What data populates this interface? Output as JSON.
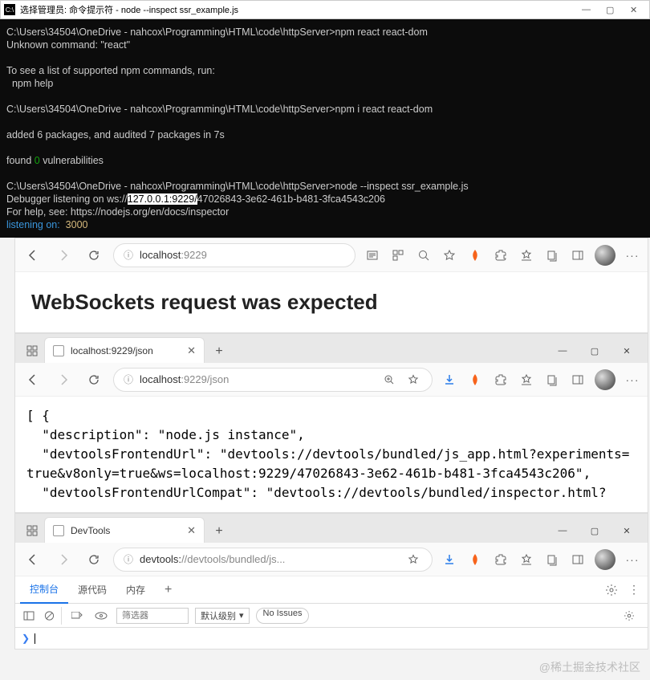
{
  "terminal": {
    "title": "选择管理员: 命令提示符 - node  --inspect ssr_example.js",
    "lines": [
      {
        "t": "C:\\Users\\34504\\OneDrive - nahcox\\Programming\\HTML\\code\\httpServer>npm react react-dom"
      },
      {
        "t": "Unknown command: \"react\""
      },
      {
        "t": ""
      },
      {
        "t": "To see a list of supported npm commands, run:"
      },
      {
        "t": "  npm help"
      },
      {
        "t": ""
      },
      {
        "t": "C:\\Users\\34504\\OneDrive - nahcox\\Programming\\HTML\\code\\httpServer>npm i react react-dom"
      },
      {
        "t": ""
      },
      {
        "t": "added 6 packages, and audited 7 packages in 7s"
      },
      {
        "t": ""
      },
      {
        "pre": "found ",
        "mid": "0",
        "suf": " vulnerabilities",
        "midcls": "green"
      },
      {
        "t": ""
      },
      {
        "t": "C:\\Users\\34504\\OneDrive - nahcox\\Programming\\HTML\\code\\httpServer>node --inspect ssr_example.js"
      },
      {
        "pre": "Debugger listening on ws://",
        "mid": "127.0.0.1:9229/",
        "suf": "47026843-3e62-461b-b481-3fca4543c206",
        "midcls": "hl"
      },
      {
        "t": "For help, see: https://nodejs.org/en/docs/inspector"
      },
      {
        "pre": "listening on:  ",
        "mid": "3000",
        "suf": "",
        "midcls": "yellow",
        "precls": "cyan"
      }
    ]
  },
  "browser1": {
    "address_host": "localhost",
    "address_path": ":9229",
    "heading": "WebSockets request was expected"
  },
  "browser2": {
    "tab_title": "localhost:9229/json",
    "address_host": "localhost",
    "address_path": ":9229/json",
    "json_body": "[ {\n  \"description\": \"node.js instance\",\n  \"devtoolsFrontendUrl\": \"devtools://devtools/bundled/js_app.html?experiments=true&v8only=true&ws=localhost:9229/47026843-3e62-461b-b481-3fca4543c206\",\n  \"devtoolsFrontendUrlCompat\": \"devtools://devtools/bundled/inspector.html?"
  },
  "browser3": {
    "tab_title": "DevTools",
    "address_host": "devtools:",
    "address_path": "//devtools/bundled/js...",
    "tabs": {
      "console": "控制台",
      "sources": "源代码",
      "memory": "内存"
    },
    "filter_placeholder": "筛选器",
    "level_label": "默认级别",
    "issues_label": "No Issues"
  },
  "watermark": "@稀土掘金技术社区"
}
